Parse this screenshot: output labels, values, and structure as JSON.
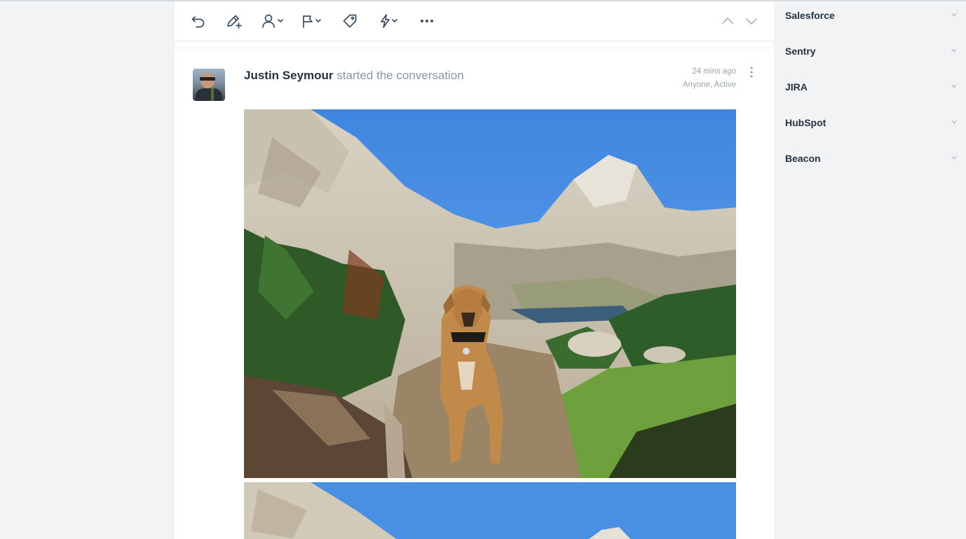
{
  "toolbar": {
    "icons": [
      "undo-icon",
      "edit-note-icon",
      "assign-user-icon",
      "status-flag-icon",
      "tag-icon",
      "workflow-bolt-icon",
      "more-icon",
      "previous-arrow-icon",
      "next-arrow-icon"
    ]
  },
  "thread": {
    "author": "Justin Seymour",
    "action": "started the conversation",
    "time": "24 mins ago",
    "status": "Anyone, Active"
  },
  "sidebar": {
    "apps": [
      {
        "label": "Salesforce"
      },
      {
        "label": "Sentry"
      },
      {
        "label": "JIRA"
      },
      {
        "label": "HubSpot"
      },
      {
        "label": "Beacon"
      }
    ]
  },
  "colors": {
    "sky": "#5b9be6",
    "accent_text": "#25333e",
    "muted_text": "#8a97a3"
  }
}
